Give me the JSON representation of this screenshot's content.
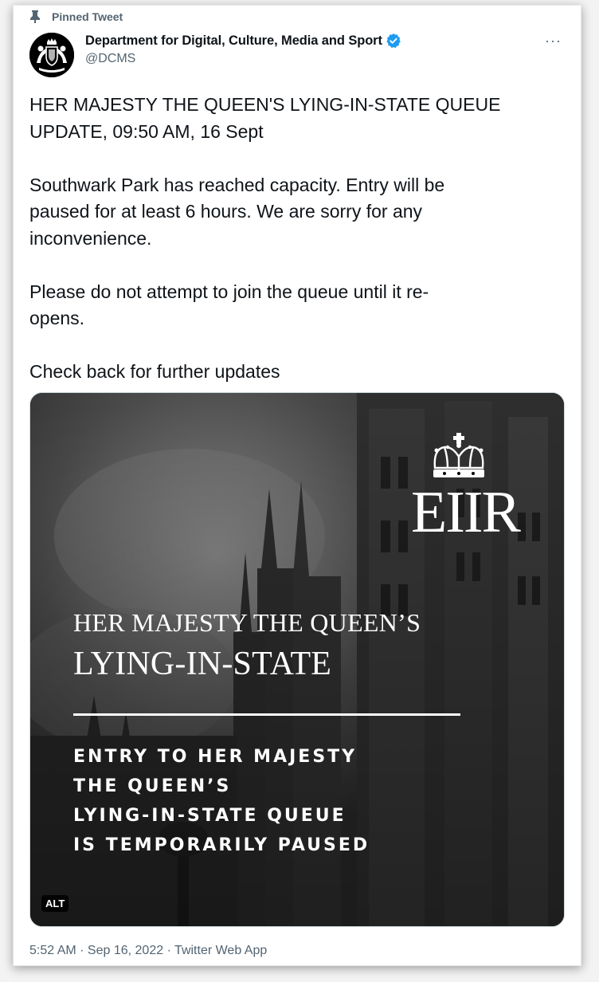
{
  "tweet": {
    "pinned_label": "Pinned Tweet",
    "author_name": "Department for Digital, Culture, Media and Sport",
    "handle": "@DCMS",
    "more_label": "···",
    "text": "HER MAJESTY THE QUEEN'S LYING-IN-STATE QUEUE\nUPDATE, 09:50 AM, 16 Sept\n\nSouthwark Park has reached capacity. Entry will be\npaused for at least 6 hours. We are sorry for any\ninconvenience.\n\nPlease do not attempt to join the queue until it re-\nopens.\n\nCheck back for further updates",
    "media": {
      "cipher": "EIIR",
      "title_line1": "HER MAJESTY THE QUEEN’S",
      "title_line2": "LYING-IN-STATE",
      "subtitle_lines": [
        "ENTRY TO HER MAJESTY",
        "THE QUEEN’S",
        "LYING-IN-STATE QUEUE",
        "IS TEMPORARILY PAUSED"
      ],
      "alt_badge": "ALT"
    },
    "timestamp": "5:52 AM · Sep 16, 2022 · Twitter Web App"
  },
  "icons": {
    "pin": "pin-icon",
    "verified": "verified-badge-icon",
    "crown": "crown-icon",
    "avatar": "royal-coat-of-arms-icon"
  },
  "colors": {
    "text_primary": "#0f1419",
    "text_secondary": "#536471",
    "verified_blue": "#1d9bf0",
    "media_dark": "#2b2b2b"
  }
}
